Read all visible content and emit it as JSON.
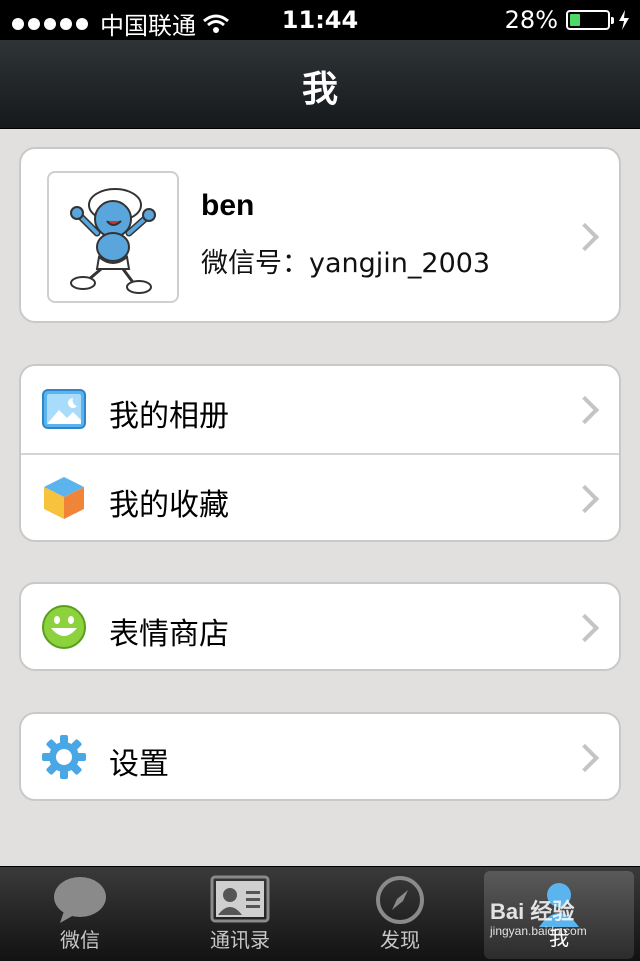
{
  "status_bar": {
    "carrier": "中国联通",
    "time": "11:44",
    "battery": "28%",
    "battery_level": 0.28
  },
  "navbar": {
    "title": "我"
  },
  "profile": {
    "name": "ben",
    "wechat_id": "微信号：yangjin_2003"
  },
  "menu": {
    "album": "我的相册",
    "favorites": "我的收藏",
    "sticker_store": "表情商店",
    "settings": "设置"
  },
  "tabbar": {
    "tabs": [
      {
        "label": "微信",
        "icon": "chat-bubble-icon"
      },
      {
        "label": "通讯录",
        "icon": "contacts-card-icon"
      },
      {
        "label": "发现",
        "icon": "compass-icon"
      },
      {
        "label": "我",
        "icon": "person-icon",
        "active": true
      }
    ]
  },
  "watermark": {
    "text": "Bai 经验",
    "url": "jingyan.baidu.com"
  },
  "colors": {
    "accent_green": "#4cd964",
    "navbar_dark": "#1e2225",
    "background": "#e1e0de",
    "icon_blue": "#4aa7e6"
  }
}
